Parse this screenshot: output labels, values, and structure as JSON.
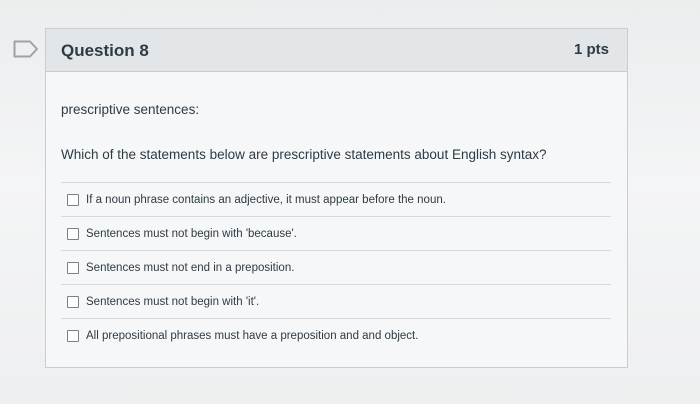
{
  "question": {
    "title": "Question 8",
    "points": "1 pts",
    "intro": "prescriptive sentences:",
    "prompt": "Which of the statements below are prescriptive statements about English syntax?"
  },
  "answers": [
    {
      "label": "If a noun phrase contains an adjective, it must appear before the noun.",
      "checked": false
    },
    {
      "label": "Sentences must not begin with 'because'.",
      "checked": false
    },
    {
      "label": "Sentences must not end in a preposition.",
      "checked": false
    },
    {
      "label": "Sentences must not begin with 'it'.",
      "checked": false
    },
    {
      "label": "All prepositional phrases must have a preposition and and object.",
      "checked": false
    }
  ],
  "icons": {
    "flag": "flag-icon"
  },
  "colors": {
    "header_bg": "#e3e6e9",
    "text": "#2d3b45",
    "border": "#c9cdd1"
  }
}
